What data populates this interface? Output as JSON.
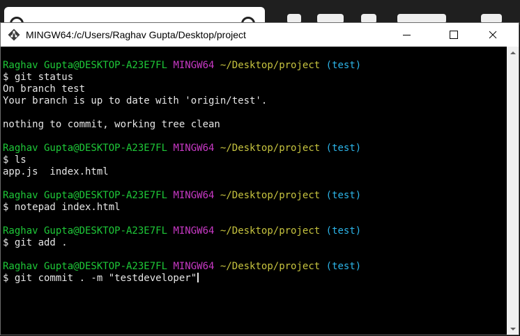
{
  "window": {
    "title": "MINGW64:/c/Users/Raghav Gupta/Desktop/project",
    "icon": "git-bash-icon"
  },
  "colors": {
    "user_host": "#1ec938",
    "shell": "#c839c5",
    "path": "#c7c43f",
    "branch": "#2cb5e9",
    "text": "#e6e6e6"
  },
  "terminal": {
    "blocks": [
      {
        "prompt": {
          "user_host": "Raghav Gupta@DESKTOP-A23E7FL",
          "shell": "MINGW64",
          "path": "~/Desktop/project",
          "branch": "(test)"
        },
        "command": "$ git status",
        "output": [
          "On branch test",
          "Your branch is up to date with 'origin/test'.",
          "",
          "nothing to commit, working tree clean"
        ]
      },
      {
        "prompt": {
          "user_host": "Raghav Gupta@DESKTOP-A23E7FL",
          "shell": "MINGW64",
          "path": "~/Desktop/project",
          "branch": "(test)"
        },
        "command": "$ ls",
        "output": [
          "app.js  index.html"
        ]
      },
      {
        "prompt": {
          "user_host": "Raghav Gupta@DESKTOP-A23E7FL",
          "shell": "MINGW64",
          "path": "~/Desktop/project",
          "branch": "(test)"
        },
        "command": "$ notepad index.html",
        "output": []
      },
      {
        "prompt": {
          "user_host": "Raghav Gupta@DESKTOP-A23E7FL",
          "shell": "MINGW64",
          "path": "~/Desktop/project",
          "branch": "(test)"
        },
        "command": "$ git add .",
        "output": []
      },
      {
        "prompt": {
          "user_host": "Raghav Gupta@DESKTOP-A23E7FL",
          "shell": "MINGW64",
          "path": "~/Desktop/project",
          "branch": "(test)"
        },
        "command": "$ git commit . -m \"testdeveloper\"",
        "output": [],
        "current": true
      }
    ]
  }
}
